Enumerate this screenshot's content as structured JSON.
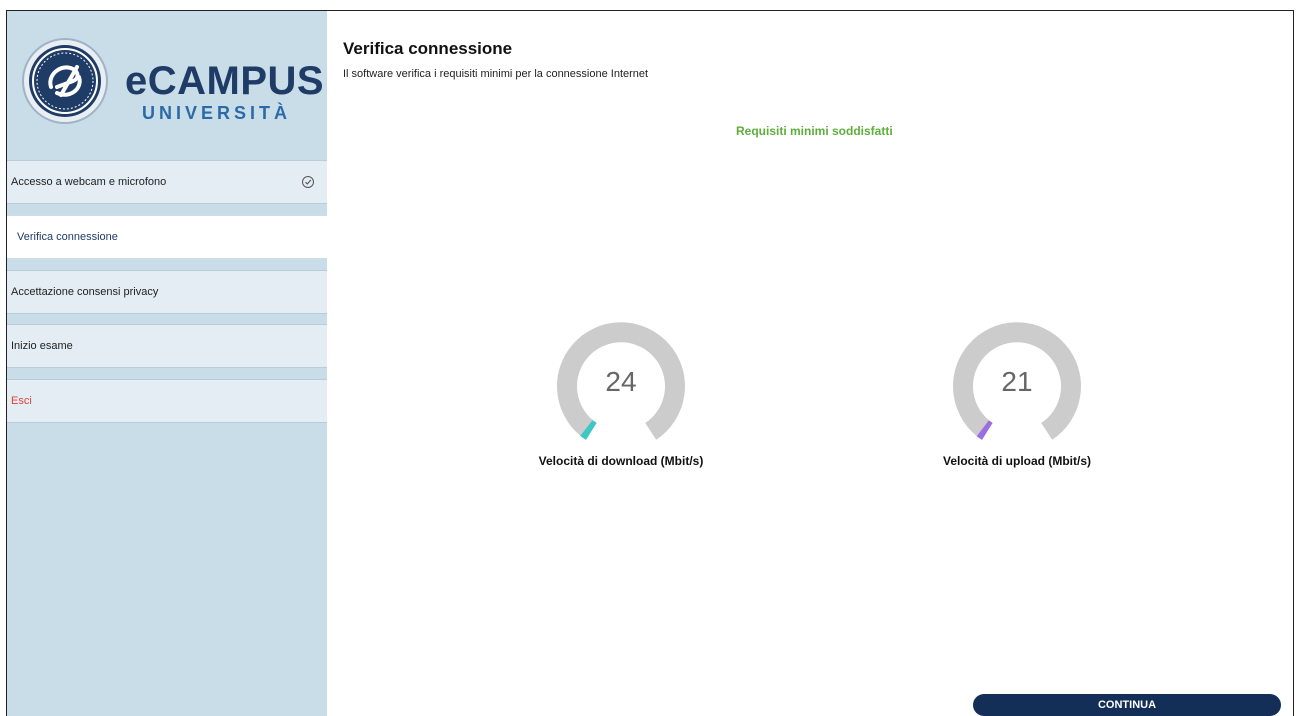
{
  "brand": {
    "name": "eCAMPUS",
    "subtitle": "UNIVERSITÀ",
    "color_primary": "#1f3c66",
    "color_secondary": "#2b6aa8"
  },
  "sidebar": {
    "items": [
      {
        "label": "Accesso a webcam e microfono",
        "icon": "check-circle-icon",
        "state": "done"
      },
      {
        "label": "Verifica connessione",
        "state": "active"
      },
      {
        "label": "Accettazione consensi privacy",
        "state": "pending"
      },
      {
        "label": "Inizio esame",
        "state": "pending"
      },
      {
        "label": "Esci",
        "state": "exit",
        "color": "#e0403a"
      }
    ]
  },
  "main": {
    "title": "Verifica connessione",
    "subtitle": "Il software verifica i requisiti minimi per la connessione Internet",
    "status": "Requisiti minimi soddisfatti",
    "status_color": "#5fae3c",
    "gauges": [
      {
        "value": "24",
        "label": "Velocità di download (Mbit/s)",
        "accent": "#3cc9c4",
        "track": "#cccccc"
      },
      {
        "value": "21",
        "label": "Velocità di upload (Mbit/s)",
        "accent": "#9a6ee0",
        "track": "#cccccc"
      }
    ],
    "continue_label": "CONTINUA",
    "continue_color": "#132f57"
  }
}
